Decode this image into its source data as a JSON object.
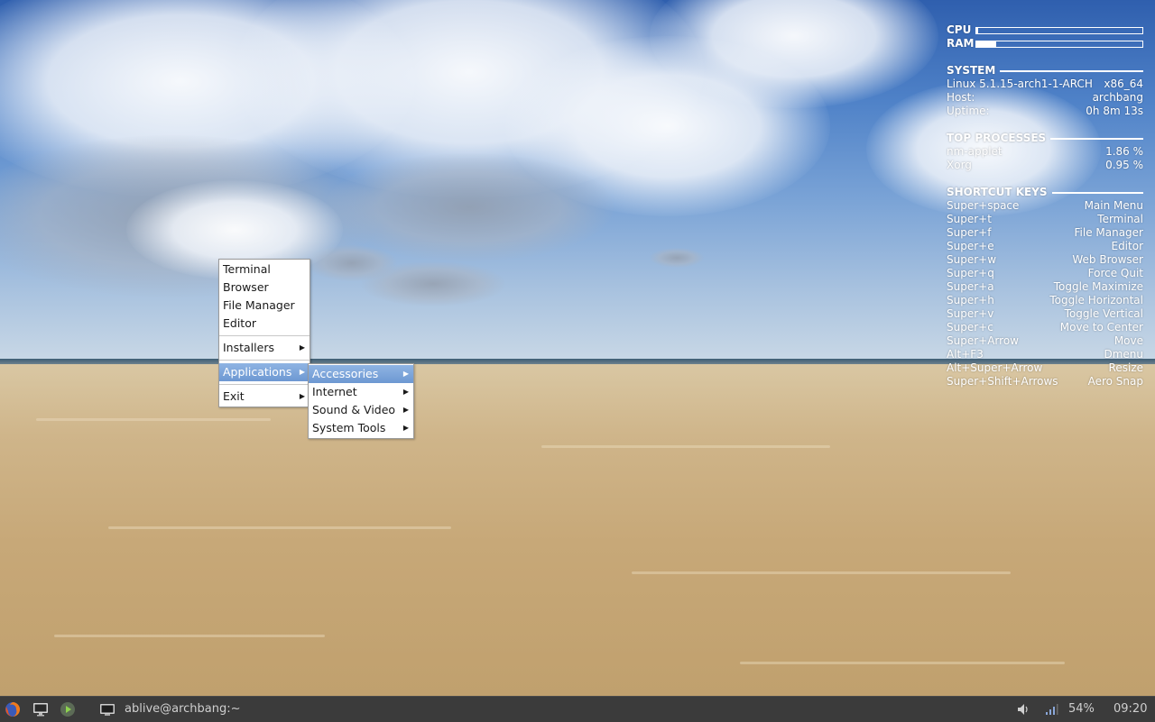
{
  "conky": {
    "cpu_label": "CPU",
    "cpu_usage": 0.01,
    "ram_label": "RAM",
    "ram_usage": 0.12,
    "system": {
      "title": "SYSTEM",
      "kernel": "Linux 5.1.15-arch1-1-ARCH",
      "arch": "x86_64",
      "host_label": "Host:",
      "host_value": "archbang",
      "uptime_label": "Uptime:",
      "uptime_value": "0h 8m 13s"
    },
    "processes": {
      "title": "TOP PROCESSES",
      "items": [
        {
          "name": "nm-applet",
          "value": "1.86 %"
        },
        {
          "name": "Xorg",
          "value": "0.95 %"
        }
      ]
    },
    "shortcuts": {
      "title": "SHORTCUT KEYS",
      "items": [
        {
          "key": "Super+space",
          "action": "Main Menu"
        },
        {
          "key": "Super+t",
          "action": "Terminal"
        },
        {
          "key": "Super+f",
          "action": "File Manager"
        },
        {
          "key": "Super+e",
          "action": "Editor"
        },
        {
          "key": "Super+w",
          "action": "Web Browser"
        },
        {
          "key": "Super+q",
          "action": "Force Quit"
        },
        {
          "key": "Super+a",
          "action": "Toggle Maximize"
        },
        {
          "key": "Super+h",
          "action": "Toggle Horizontal"
        },
        {
          "key": "Super+v",
          "action": "Toggle Vertical"
        },
        {
          "key": "Super+c",
          "action": "Move to Center"
        },
        {
          "key": "Super+Arrow",
          "action": "Move"
        },
        {
          "key": "Alt+F3",
          "action": "Dmenu"
        },
        {
          "key": "Alt+Super+Arrow",
          "action": "Resize"
        },
        {
          "key": "Super+Shift+Arrows",
          "action": "Aero Snap"
        }
      ]
    }
  },
  "menu": {
    "terminal": "Terminal",
    "browser": "Browser",
    "file_manager": "File Manager",
    "editor": "Editor",
    "installers": "Installers",
    "applications": "Applications",
    "exit": "Exit",
    "submenu": {
      "accessories": "Accessories",
      "internet": "Internet",
      "sound_video": "Sound & Video",
      "system_tools": "System Tools"
    }
  },
  "taskbar": {
    "window_title": "ablive@archbang:~",
    "battery": "54%",
    "clock": "09:20",
    "launchers": [
      "firefox-icon",
      "desktop-icon",
      "media-player-icon"
    ]
  },
  "colors": {
    "menu_highlight": "#7aa3d9",
    "taskbar_bg": "#3b3b3b"
  }
}
